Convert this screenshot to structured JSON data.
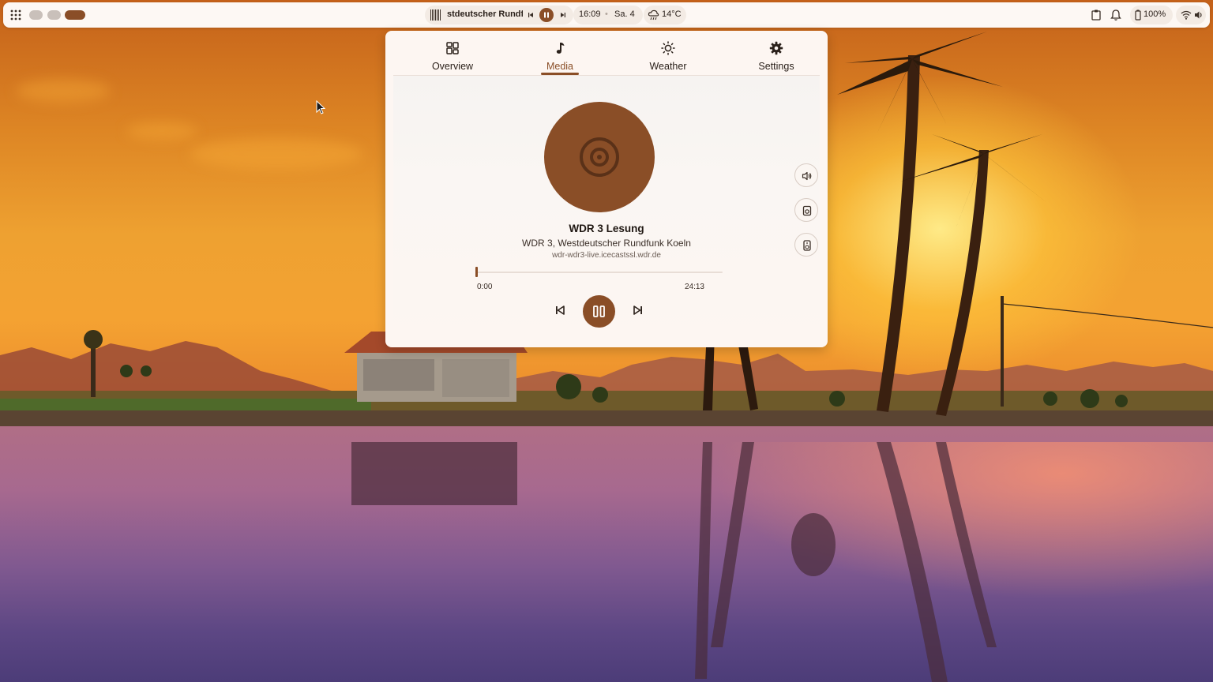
{
  "topbar": {
    "media_title": "stdeutscher Rundfur",
    "time": "16:09",
    "date": "Sa. 4",
    "weather": "14°C",
    "battery": "100%"
  },
  "panel": {
    "tabs": [
      {
        "label": "Overview",
        "icon": "grid-icon"
      },
      {
        "label": "Media",
        "icon": "music-note-icon",
        "active": true
      },
      {
        "label": "Weather",
        "icon": "sun-icon"
      },
      {
        "label": "Settings",
        "icon": "gear-icon"
      }
    ],
    "media": {
      "title": "WDR 3 Lesung",
      "artist": "WDR 3, Westdeutscher Rundfunk Koeln",
      "source": "wdr-wdr3-live.icecastssl.wdr.de",
      "position": "0:00",
      "duration": "24:13",
      "progress": 0.0
    },
    "side_buttons": [
      "volume-icon",
      "speaker-icon",
      "device-icon"
    ]
  },
  "colors": {
    "accent": "#8a4e27",
    "panel_bg": "#fdf6f2",
    "text": "#1f1712"
  }
}
